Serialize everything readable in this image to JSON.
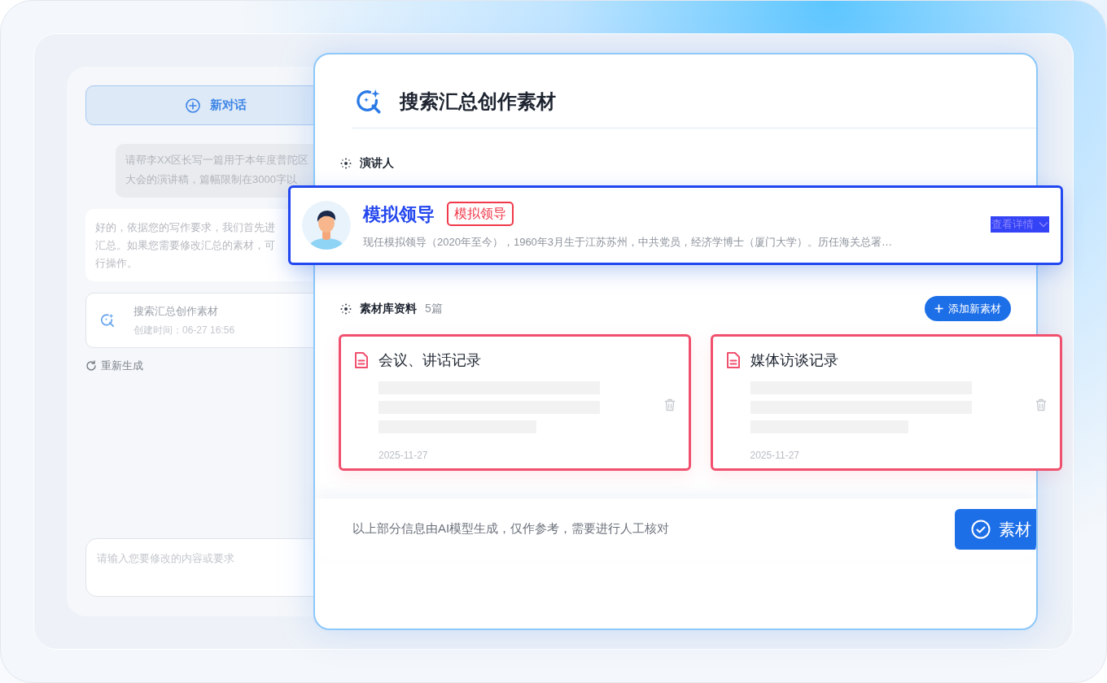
{
  "sidebar": {
    "new_chat_button": "新对话",
    "user_message_lines": [
      "请帮李XX区长写一篇用于本年度普陀区",
      "大会的演讲稿，篇幅限制在3000字以"
    ],
    "reply_lines": [
      "好的，依据您的写作要求，我们首先进",
      "汇总。如果您需要修改汇总的素材，可",
      "行操作。"
    ],
    "task_card": {
      "title": "搜索汇总创作素材",
      "created": "创建时间：06-27 16:56"
    },
    "regenerate": "重新生成",
    "input": {
      "placeholder": "请输入您要修改的内容或要求"
    }
  },
  "dialog": {
    "title": "搜索汇总创作素材",
    "speaker_section": {
      "label": "演讲人"
    },
    "speaker": {
      "name": "模拟领导",
      "tag": "模拟领导",
      "bio": "现任模拟领导（2020年至今），1960年3月生于江苏苏州，中共党员，经济学博士（厦门大学）。历任海关总署…",
      "details_link": "查看详情",
      "highlighted": true
    },
    "materials_section": {
      "label": "素材库资料",
      "count": "5篇",
      "add_button": "添加新素材"
    },
    "materials": [
      {
        "title": "会议、讲话记录",
        "date": "2025-11-27",
        "selected": true
      },
      {
        "title": "媒体访谈记录",
        "date": "2025-11-27",
        "selected": true
      }
    ],
    "footer": {
      "note": "以上部分信息由AI模型生成，仅作参考，需要进行人工核对",
      "confirm_button": "素材"
    }
  }
}
